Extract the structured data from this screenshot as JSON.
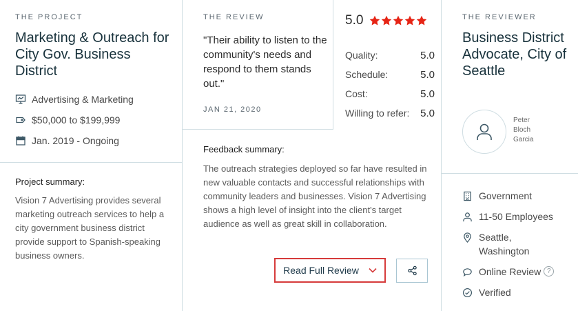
{
  "project": {
    "eyebrow": "THE PROJECT",
    "title": "Marketing & Outreach for City Gov. Business District",
    "meta": [
      {
        "icon": "presentation-icon",
        "text": "Advertising & Marketing"
      },
      {
        "icon": "price-tag-icon",
        "text": "$50,000 to $199,999"
      },
      {
        "icon": "calendar-icon",
        "text": "Jan. 2019 - Ongoing"
      }
    ],
    "summary_label": "Project summary:",
    "summary_text": "Vision 7 Advertising provides several marketing outreach services to help a city government business district provide support to Spanish-speaking business owners."
  },
  "review": {
    "eyebrow": "THE REVIEW",
    "quote": "\"Their ability to listen to the community's needs and respond to them stands out.\"",
    "date": "JAN 21, 2020",
    "overall_score": "5.0",
    "stars": 5,
    "star_color": "#e62415",
    "ratings": [
      {
        "label": "Quality:",
        "value": "5.0"
      },
      {
        "label": "Schedule:",
        "value": "5.0"
      },
      {
        "label": "Cost:",
        "value": "5.0"
      },
      {
        "label": "Willing to refer:",
        "value": "5.0"
      }
    ],
    "feedback_label": "Feedback summary:",
    "feedback_text": "The outreach strategies deployed so far have resulted in new valuable contacts and successful relationships with community leaders and businesses. Vision 7 Advertising shows a high level of insight into the client's target audience as well as great skill in collaboration.",
    "read_button": "Read Full Review",
    "accent_color": "#d63b3b"
  },
  "reviewer": {
    "eyebrow": "THE REVIEWER",
    "title": "Business District Advocate, City of Seattle",
    "name": "Peter Bloch Garcia",
    "details": [
      {
        "icon": "building-icon",
        "text": "Government"
      },
      {
        "icon": "person-icon",
        "text": "11-50 Employees"
      },
      {
        "icon": "location-pin-icon",
        "text": "Seattle, Washington"
      },
      {
        "icon": "chat-bubble-icon",
        "text": "Online Review",
        "help": "?"
      },
      {
        "icon": "check-circle-icon",
        "text": "Verified"
      }
    ]
  }
}
